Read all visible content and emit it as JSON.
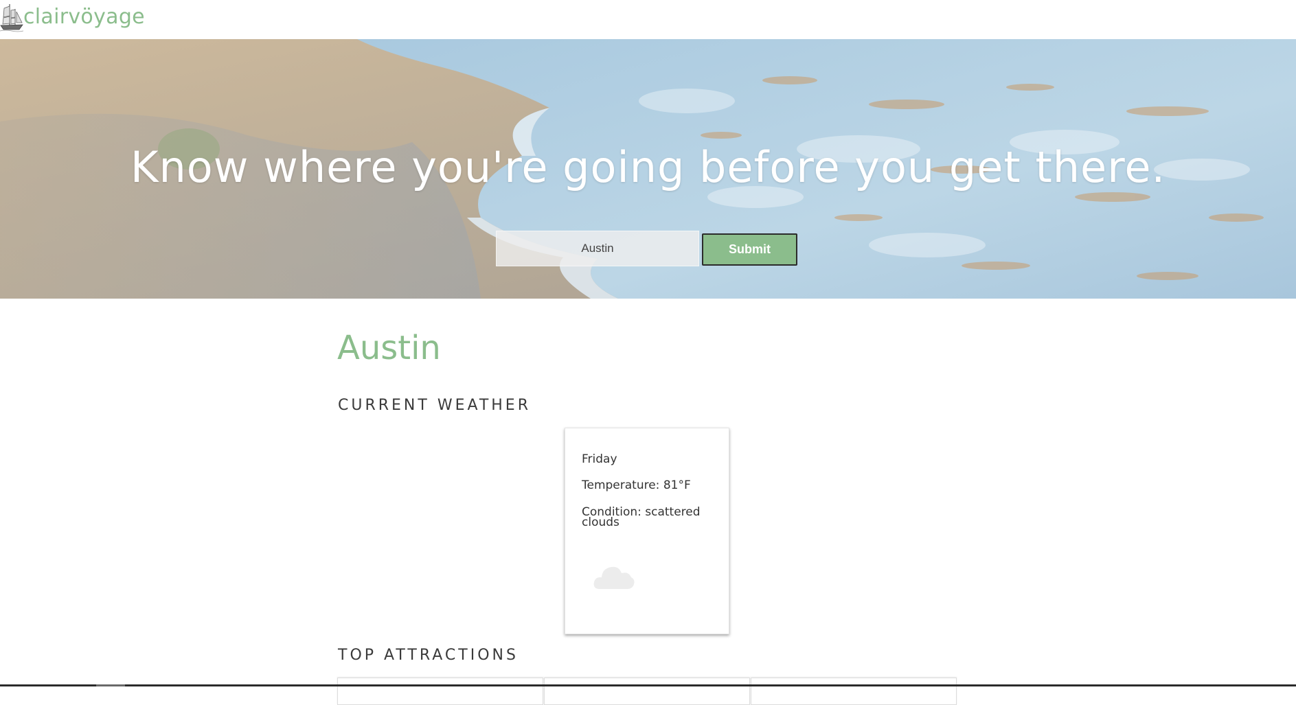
{
  "brand": {
    "name": "clairvöyage",
    "icon": "ship-icon",
    "color": "#8bbd8c"
  },
  "hero": {
    "headline": "Know where you're going before you get there.",
    "background": "beach-waves-image",
    "search": {
      "value": "Austin",
      "placeholder": ""
    },
    "submit_label": "Submit"
  },
  "results": {
    "city": "Austin",
    "weather_heading": "CURRENT WEATHER",
    "weather": {
      "day": "Friday",
      "temperature": "Temperature: 81°F",
      "condition": "Condition: scattered clouds",
      "icon": "cloud-icon"
    },
    "attractions_heading": "TOP ATTRACTIONS"
  },
  "colors": {
    "accent": "#8bbd8c",
    "text": "#3a3a3a"
  }
}
